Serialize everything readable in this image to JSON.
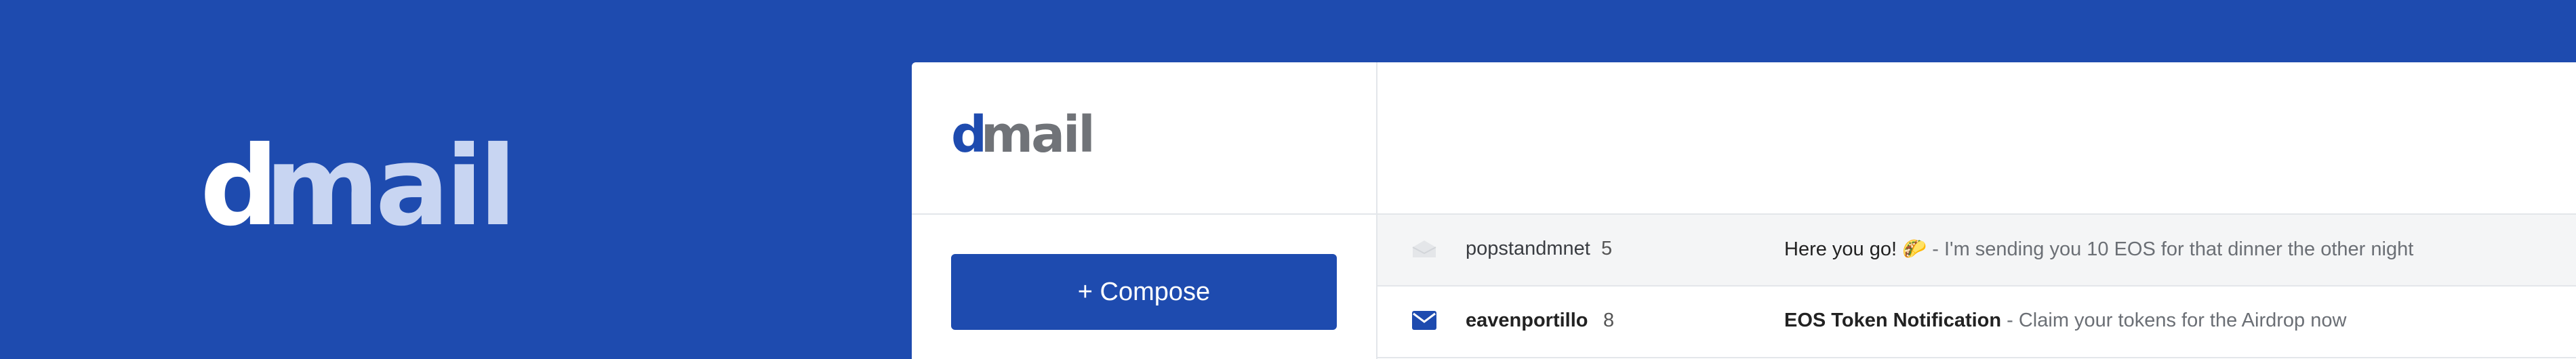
{
  "hero": {
    "logo_d": "d",
    "logo_rest": "mail"
  },
  "app": {
    "brand": {
      "logo_d": "d",
      "logo_rest": "mail"
    },
    "compose_label": "+ Compose",
    "messages": [
      {
        "sender": "popstandmnet",
        "count": "5",
        "subject": "Here you go! 🌮",
        "snippet": " - I'm sending you 10 EOS for that dinner the other night",
        "read": true,
        "icon": "envelope-open-icon"
      },
      {
        "sender": "eavenportillo",
        "count": "8",
        "subject": "EOS Token Notification",
        "snippet": " - Claim your tokens for the Airdrop now",
        "read": false,
        "icon": "envelope-icon"
      }
    ]
  },
  "colors": {
    "brand_blue": "#1e4baf",
    "hero_light": "#c8d5f2",
    "brand_gray": "#707378",
    "read_row_bg": "#f4f5f6"
  }
}
